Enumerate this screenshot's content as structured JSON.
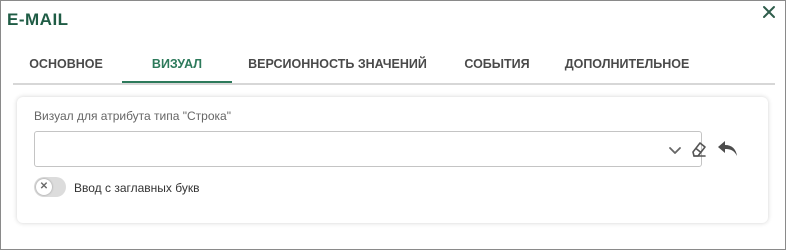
{
  "dialog": {
    "title": "E-MAIL",
    "close_icon": "close-icon",
    "accent_color": "#2d7a5b",
    "title_color": "#1f5c45"
  },
  "tabs": [
    {
      "label": "ОСНОВНОЕ",
      "active": false
    },
    {
      "label": "ВИЗУАЛ",
      "active": true
    },
    {
      "label": "ВЕРСИОННОСТЬ ЗНАЧЕНИЙ",
      "active": false
    },
    {
      "label": "СОБЫТИЯ",
      "active": false
    },
    {
      "label": "ДОПОЛНИТЕЛЬНОЕ",
      "active": false
    }
  ],
  "visual": {
    "field_label": "Визуал для атрибута типа \"Строка\"",
    "select_value": "",
    "icons": [
      "chevron-down-icon",
      "eraser-icon",
      "undo-icon"
    ],
    "toggle": {
      "label": "Ввод с заглавных букв",
      "enabled": false,
      "knob_icon": "x-icon"
    }
  }
}
